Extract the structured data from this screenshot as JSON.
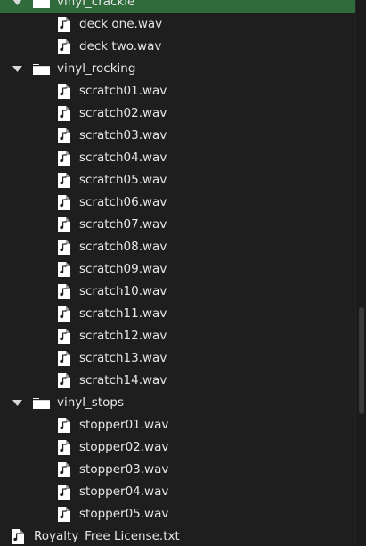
{
  "tree": [
    {
      "type": "folder",
      "name": "vinyl_crackle",
      "expanded": true,
      "selected": true,
      "children": [
        "deck one.wav",
        "deck two.wav"
      ]
    },
    {
      "type": "folder",
      "name": "vinyl_rocking",
      "expanded": true,
      "selected": false,
      "children": [
        "scratch01.wav",
        "scratch02.wav",
        "scratch03.wav",
        "scratch04.wav",
        "scratch05.wav",
        "scratch06.wav",
        "scratch07.wav",
        "scratch08.wav",
        "scratch09.wav",
        "scratch10.wav",
        "scratch11.wav",
        "scratch12.wav",
        "scratch13.wav",
        "scratch14.wav"
      ]
    },
    {
      "type": "folder",
      "name": "vinyl_stops",
      "expanded": true,
      "selected": false,
      "children": [
        "stopper01.wav",
        "stopper02.wav",
        "stopper03.wav",
        "stopper04.wav",
        "stopper05.wav"
      ]
    },
    {
      "type": "file",
      "name": "Royalty_Free License.txt"
    }
  ],
  "icons": {
    "expand": "chevron-down-icon",
    "folder": "folder-icon",
    "file": "audio-file-icon"
  },
  "colors": {
    "background": "#1e1e1e",
    "selection": "#2f6b3b",
    "text": "#e6e6e6",
    "icon": "#ffffff"
  }
}
